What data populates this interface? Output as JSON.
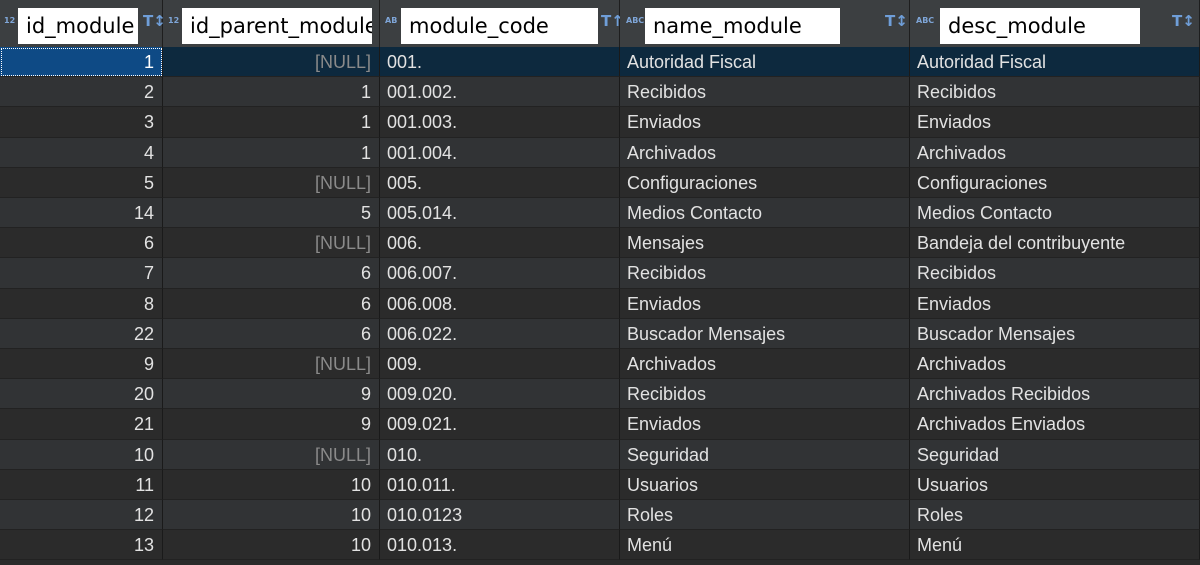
{
  "columns": [
    {
      "name": "id_module",
      "type_icon": "123",
      "sort_icon": "sort-filter-icon"
    },
    {
      "name": "id_parent_module",
      "type_icon": "123",
      "sort_icon": ""
    },
    {
      "name": "module_code",
      "type_icon": "ABC",
      "sort_icon": "sort-filter-icon"
    },
    {
      "name": "name_module",
      "type_icon": "ABC",
      "sort_icon": "sort-filter-icon"
    },
    {
      "name": "desc_module",
      "type_icon": "ABC",
      "sort_icon": "sort-filter-icon"
    }
  ],
  "rows": [
    {
      "id_module": "1",
      "id_parent_module": "[NULL]",
      "module_code": "001.",
      "name_module": "Autoridad Fiscal",
      "desc_module": "Autoridad Fiscal"
    },
    {
      "id_module": "2",
      "id_parent_module": "1",
      "module_code": "001.002.",
      "name_module": "Recibidos",
      "desc_module": "Recibidos"
    },
    {
      "id_module": "3",
      "id_parent_module": "1",
      "module_code": "001.003.",
      "name_module": "Enviados",
      "desc_module": "Enviados"
    },
    {
      "id_module": "4",
      "id_parent_module": "1",
      "module_code": "001.004.",
      "name_module": "Archivados",
      "desc_module": "Archivados"
    },
    {
      "id_module": "5",
      "id_parent_module": "[NULL]",
      "module_code": "005.",
      "name_module": "Configuraciones",
      "desc_module": "Configuraciones"
    },
    {
      "id_module": "14",
      "id_parent_module": "5",
      "module_code": "005.014.",
      "name_module": "Medios Contacto",
      "desc_module": "Medios Contacto"
    },
    {
      "id_module": "6",
      "id_parent_module": "[NULL]",
      "module_code": "006.",
      "name_module": "Mensajes",
      "desc_module": "Bandeja del contribuyente"
    },
    {
      "id_module": "7",
      "id_parent_module": "6",
      "module_code": "006.007.",
      "name_module": "Recibidos",
      "desc_module": "Recibidos"
    },
    {
      "id_module": "8",
      "id_parent_module": "6",
      "module_code": "006.008.",
      "name_module": "Enviados",
      "desc_module": "Enviados"
    },
    {
      "id_module": "22",
      "id_parent_module": "6",
      "module_code": "006.022.",
      "name_module": "Buscador Mensajes",
      "desc_module": "Buscador Mensajes"
    },
    {
      "id_module": "9",
      "id_parent_module": "[NULL]",
      "module_code": "009.",
      "name_module": "Archivados",
      "desc_module": "Archivados"
    },
    {
      "id_module": "20",
      "id_parent_module": "9",
      "module_code": "009.020.",
      "name_module": "Recibidos",
      "desc_module": "Archivados Recibidos"
    },
    {
      "id_module": "21",
      "id_parent_module": "9",
      "module_code": "009.021.",
      "name_module": "Enviados",
      "desc_module": "Archivados Enviados"
    },
    {
      "id_module": "10",
      "id_parent_module": "[NULL]",
      "module_code": "010.",
      "name_module": "Seguridad",
      "desc_module": "Seguridad"
    },
    {
      "id_module": "11",
      "id_parent_module": "10",
      "module_code": "010.011.",
      "name_module": "Usuarios",
      "desc_module": "Usuarios"
    },
    {
      "id_module": "12",
      "id_parent_module": "10",
      "module_code": "010.0123",
      "name_module": "Roles",
      "desc_module": "Roles"
    },
    {
      "id_module": "13",
      "id_parent_module": "10",
      "module_code": "010.013.",
      "name_module": "Menú",
      "desc_module": "Menú"
    }
  ],
  "null_label": "[NULL]",
  "colors": {
    "grid_bg": "#2b2b2b",
    "row_alt_bg": "#313335",
    "selected_bg": "#0e4a85",
    "text": "#e2e2e2",
    "null_text": "#8a8a8a",
    "icon_accent": "#6f9ed8"
  }
}
